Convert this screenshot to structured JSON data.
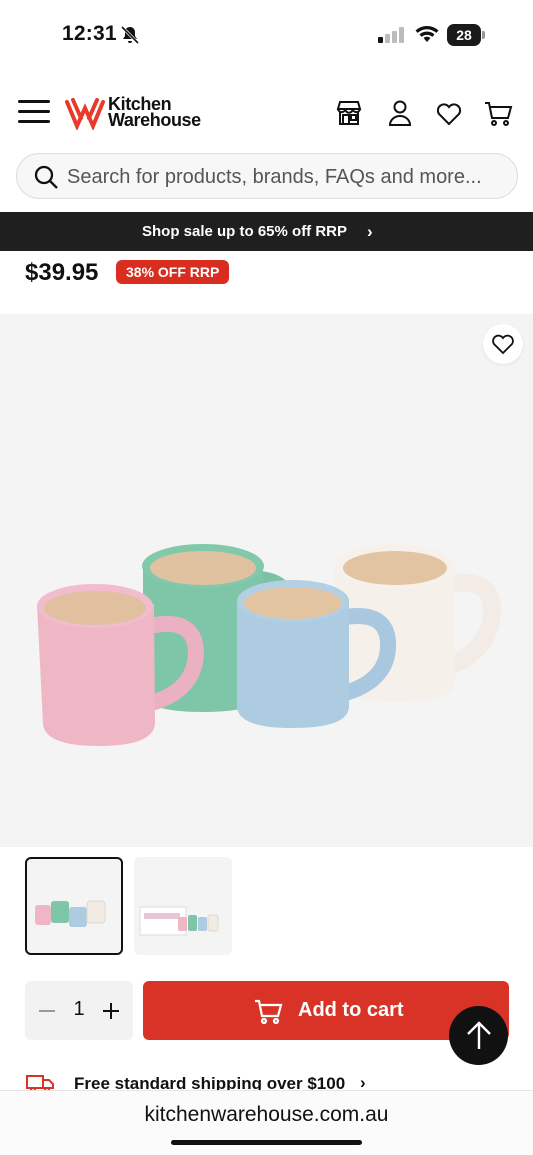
{
  "status_bar": {
    "time": "12:31",
    "battery": "28"
  },
  "header": {
    "logo_line1": "Kitchen",
    "logo_line2": "Warehouse",
    "brand_color": "#e8392b"
  },
  "search": {
    "placeholder": "Search for products, brands, FAQs and more..."
  },
  "promo": {
    "text": "Shop sale up to 65% off RRP",
    "arrow": "›"
  },
  "product": {
    "price": "$39.95",
    "discount_badge": "38% OFF RRP",
    "accent_color": "#d92d20",
    "image_alt": "Four pastel mugs - pink, green, blue, cream",
    "thumbnails": [
      "mugs",
      "boxed-set"
    ]
  },
  "purchase": {
    "quantity": "1",
    "add_to_cart_label": "Add to cart"
  },
  "shipping": {
    "text": "Free standard shipping over $100",
    "arrow": "›"
  },
  "browser": {
    "url": "kitchenwarehouse.com.au"
  }
}
